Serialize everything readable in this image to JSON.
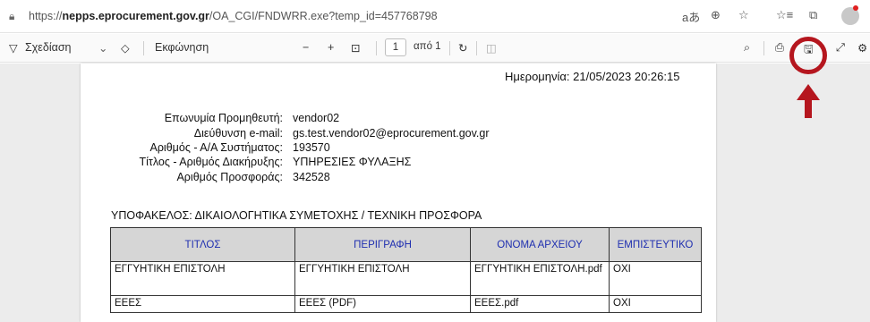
{
  "browser": {
    "url_prefix": "https://",
    "url_domain": "nepps.eprocurement.gov.gr",
    "url_path": "/OA_CGI/FNDWRR.exe?temp_id=457768798",
    "icons": [
      "lock-icon",
      "read-aloud-icon",
      "zoom-icon",
      "favorite-icon",
      "favorites-icon",
      "collections-icon",
      "profile-avatar"
    ]
  },
  "toolbar": {
    "draw_label": "Σχεδίαση",
    "read_aloud_label": "Εκφώνηση",
    "page_current": "1",
    "page_total": "από 1"
  },
  "document": {
    "date_label": "Ημερομηνία:",
    "date_value": "21/05/2023 20:26:15",
    "supplier_name_label": "Επωνυμία Προμηθευτή:",
    "supplier_name_value": "vendor02",
    "email_label": "Διεύθυνση e-mail:",
    "email_value": "gs.test.vendor02@eprocurement.gov.gr",
    "system_no_label": "Αριθμός - Α/Α Συστήματος:",
    "system_no_value": "193570",
    "tender_label": "Τίτλος - Αριθμός Διακήρυξης:",
    "tender_value": "ΥΠΗΡΕΣΙΕΣ ΦΥΛΑΞΗΣ",
    "offer_no_label": "Αριθμός Προσφοράς:",
    "offer_no_value": "342528",
    "subfolder": "ΥΠΟΦΑΚΕΛΟΣ: ΔΙΚΑΙΟΛΟΓΗΤΙΚΑ ΣΥΜΕΤΟΧΗΣ / ΤΕΧΝΙΚΗ ΠΡΟΣΦΟΡΑ",
    "columns": [
      "ΤΙΤΛΟΣ",
      "ΠΕΡΙΓΡΑΦΗ",
      "ΟΝΟΜΑ ΑΡΧΕΙΟΥ",
      "ΕΜΠΙΣΤΕΥΤΙΚΟ"
    ],
    "rows": [
      [
        "ΕΓΓΥΗΤΙΚΗ ΕΠΙΣΤΟΛΗ",
        "ΕΓΓΥΗΤΙΚΗ ΕΠΙΣΤΟΛΗ",
        "ΕΓΓΥΗΤΙΚΗ ΕΠΙΣΤΟΛΗ.pdf",
        "ΟΧΙ"
      ],
      [
        "ΕΕΕΣ",
        "ΕΕΕΣ (PDF)",
        "ΕΕΕΣ.pdf",
        "ΟΧΙ"
      ]
    ]
  },
  "annotation": {
    "highlight_color": "#b5161e",
    "target": "save-icon"
  }
}
